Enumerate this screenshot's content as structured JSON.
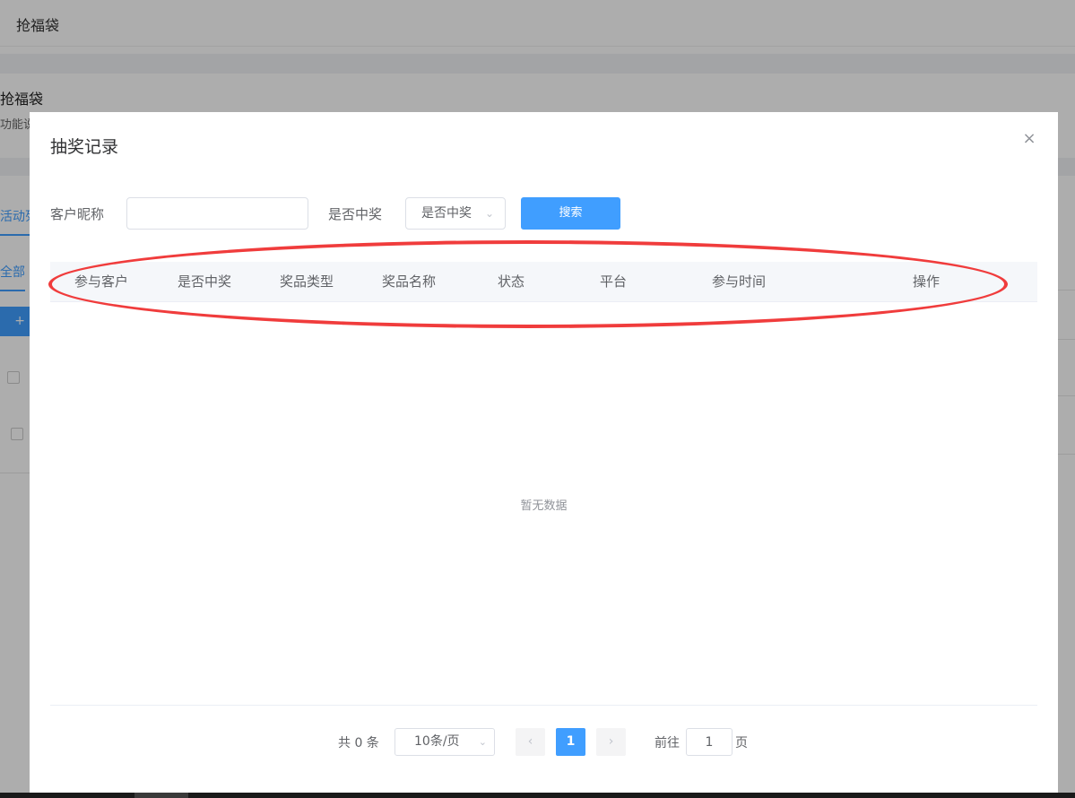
{
  "background": {
    "topbar_title": "抢福袋",
    "header_title": "抢福袋",
    "header_desc": "功能说",
    "tab_label": "活动列",
    "subtab_label": "全部",
    "button_label": "+"
  },
  "dialog": {
    "title": "抽奖记录",
    "close_icon": "×",
    "filters": {
      "nickname_label": "客户昵称",
      "nickname_value": "",
      "win_label": "是否中奖",
      "win_select_value": "是否中奖",
      "search_button": "搜索"
    },
    "table": {
      "columns": [
        "参与客户",
        "是否中奖",
        "奖品类型",
        "奖品名称",
        "状态",
        "平台",
        "参与时间",
        "操作"
      ],
      "rows": [],
      "empty_text": "暂无数据"
    },
    "pagination": {
      "total_text": "共 0 条",
      "page_size": "10条/页",
      "current_page": "1",
      "goto_label": "前往",
      "goto_value": "1",
      "page_unit": "页"
    }
  },
  "colors": {
    "primary": "#409eff",
    "annotation": "#f03c3c"
  }
}
